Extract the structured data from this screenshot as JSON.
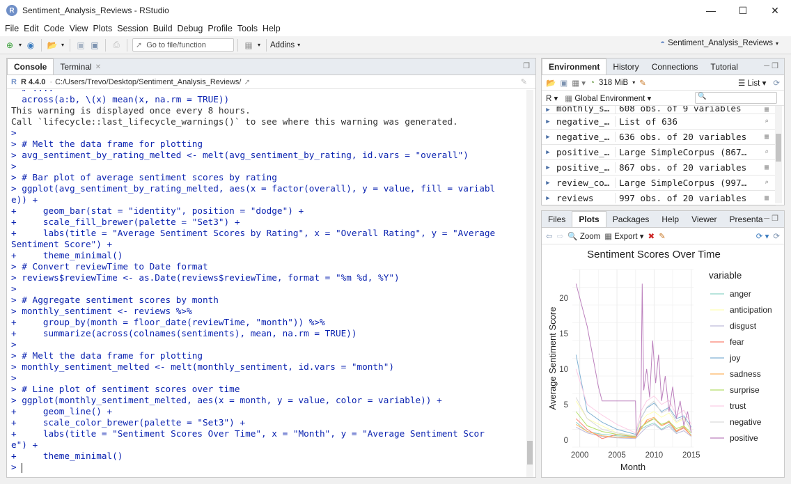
{
  "window": {
    "title": "Sentiment_Analysis_Reviews - RStudio"
  },
  "menu": [
    "File",
    "Edit",
    "Code",
    "View",
    "Plots",
    "Session",
    "Build",
    "Debug",
    "Profile",
    "Tools",
    "Help"
  ],
  "toolbar": {
    "goto_label": "Go to file/function",
    "addins_label": "Addins",
    "project_label": "Sentiment_Analysis_Reviews"
  },
  "left": {
    "tabs": [
      "Console",
      "Terminal"
    ],
    "r_version": "R 4.4.0",
    "path": "C:/Users/Trevo/Desktop/Sentiment_Analysis_Reviews/",
    "lines": [
      {
        "cls": "cmd",
        "text": "  # ...."
      },
      {
        "cls": "cmd",
        "text": "  across(a:b, \\(x) mean(x, na.rm = TRUE))"
      },
      {
        "cls": "out",
        "text": "This warning is displayed once every 8 hours."
      },
      {
        "cls": "out",
        "text": "Call `lifecycle::last_lifecycle_warnings()` to see where this warning was generated."
      },
      {
        "cls": "cmd",
        "text": ">"
      },
      {
        "cls": "cmd",
        "text": "> # Melt the data frame for plotting"
      },
      {
        "cls": "cmd",
        "text": "> avg_sentiment_by_rating_melted <- melt(avg_sentiment_by_rating, id.vars = \"overall\")"
      },
      {
        "cls": "cmd",
        "text": ">"
      },
      {
        "cls": "cmd",
        "text": "> # Bar plot of average sentiment scores by rating"
      },
      {
        "cls": "cmd",
        "text": "> ggplot(avg_sentiment_by_rating_melted, aes(x = factor(overall), y = value, fill = variabl"
      },
      {
        "cls": "cmd",
        "text": "e)) +"
      },
      {
        "cls": "cmd",
        "text": "+     geom_bar(stat = \"identity\", position = \"dodge\") +"
      },
      {
        "cls": "cmd",
        "text": "+     scale_fill_brewer(palette = \"Set3\") +"
      },
      {
        "cls": "cmd",
        "text": "+     labs(title = \"Average Sentiment Scores by Rating\", x = \"Overall Rating\", y = \"Average"
      },
      {
        "cls": "cmd",
        "text": "Sentiment Score\") +"
      },
      {
        "cls": "cmd",
        "text": "+     theme_minimal()"
      },
      {
        "cls": "cmd",
        "text": "> # Convert reviewTime to Date format"
      },
      {
        "cls": "cmd",
        "text": "> reviews$reviewTime <- as.Date(reviews$reviewTime, format = \"%m %d, %Y\")"
      },
      {
        "cls": "cmd",
        "text": ">"
      },
      {
        "cls": "cmd",
        "text": "> # Aggregate sentiment scores by month"
      },
      {
        "cls": "cmd",
        "text": "> monthly_sentiment <- reviews %>%"
      },
      {
        "cls": "cmd",
        "text": "+     group_by(month = floor_date(reviewTime, \"month\")) %>%"
      },
      {
        "cls": "cmd",
        "text": "+     summarize(across(colnames(sentiments), mean, na.rm = TRUE))"
      },
      {
        "cls": "cmd",
        "text": ">"
      },
      {
        "cls": "cmd",
        "text": "> # Melt the data frame for plotting"
      },
      {
        "cls": "cmd",
        "text": "> monthly_sentiment_melted <- melt(monthly_sentiment, id.vars = \"month\")"
      },
      {
        "cls": "cmd",
        "text": ">"
      },
      {
        "cls": "cmd",
        "text": "> # Line plot of sentiment scores over time"
      },
      {
        "cls": "cmd",
        "text": "> ggplot(monthly_sentiment_melted, aes(x = month, y = value, color = variable)) +"
      },
      {
        "cls": "cmd",
        "text": "+     geom_line() +"
      },
      {
        "cls": "cmd",
        "text": "+     scale_color_brewer(palette = \"Set3\") +"
      },
      {
        "cls": "cmd",
        "text": "+     labs(title = \"Sentiment Scores Over Time\", x = \"Month\", y = \"Average Sentiment Scor"
      },
      {
        "cls": "cmd",
        "text": "e\") +"
      },
      {
        "cls": "cmd",
        "text": "+     theme_minimal()"
      },
      {
        "cls": "cmd",
        "text": "> "
      }
    ]
  },
  "env": {
    "tabs": [
      "Environment",
      "History",
      "Connections",
      "Tutorial"
    ],
    "memory": "318 MiB",
    "list_label": "List",
    "lang": "R",
    "scope": "Global Environment",
    "rows": [
      {
        "name": "monthly_s…",
        "value": "608 obs. of 9 variables"
      },
      {
        "name": "negative_…",
        "value": "List of  636"
      },
      {
        "name": "negative_…",
        "value": "636 obs. of 20 variables"
      },
      {
        "name": "positive_…",
        "value": "Large SimpleCorpus (867…"
      },
      {
        "name": "positive_…",
        "value": "867 obs. of 20 variables"
      },
      {
        "name": "review_co…",
        "value": "Large SimpleCorpus (997…"
      },
      {
        "name": "reviews",
        "value": "997 obs. of 20 variables"
      }
    ]
  },
  "plots": {
    "tabs": [
      "Files",
      "Plots",
      "Packages",
      "Help",
      "Viewer",
      "Presenta"
    ],
    "zoom_label": "Zoom",
    "export_label": "Export"
  },
  "chart_data": {
    "type": "line",
    "title": "Sentiment Scores Over Time",
    "xlabel": "Month",
    "ylabel": "Average Sentiment Score",
    "xlim": [
      1999,
      2015.3
    ],
    "ylim": [
      -1,
      24
    ],
    "xticks": [
      2000,
      2005,
      2010,
      2015
    ],
    "yticks": [
      0,
      5,
      10,
      15,
      20
    ],
    "grid": true,
    "legend_title": "variable",
    "legend_position": "right",
    "series": [
      {
        "name": "anger",
        "color": "#8DD3C7",
        "x": [
          1999.5,
          2001,
          2003,
          2005,
          2007.5,
          2008.2,
          2009,
          2010,
          2011,
          2012,
          2013,
          2014,
          2015
        ],
        "y": [
          2.5,
          1.2,
          0.8,
          0.6,
          0.4,
          1.5,
          2.0,
          2.4,
          1.5,
          2.2,
          1.1,
          1.8,
          0.7
        ]
      },
      {
        "name": "anticipation",
        "color": "#FFFFB3",
        "x": [
          1999.5,
          2001,
          2003,
          2005,
          2007.5,
          2008.2,
          2009,
          2010,
          2011,
          2012,
          2013,
          2014,
          2015
        ],
        "y": [
          5.5,
          3.0,
          2.0,
          1.0,
          0.6,
          2.5,
          3.5,
          4.0,
          3.2,
          3.8,
          2.4,
          3.0,
          1.5
        ]
      },
      {
        "name": "disgust",
        "color": "#BEBADA",
        "x": [
          1999.5,
          2001,
          2003,
          2005,
          2007.5,
          2008.2,
          2009,
          2010,
          2011,
          2012,
          2013,
          2014,
          2015
        ],
        "y": [
          1.8,
          1.0,
          0.5,
          0.3,
          0.2,
          1.0,
          1.8,
          2.2,
          1.4,
          1.9,
          0.9,
          1.3,
          0.5
        ]
      },
      {
        "name": "fear",
        "color": "#FB8072",
        "x": [
          1999.5,
          2001,
          2003,
          2005,
          2007.5,
          2008.2,
          2009,
          2010,
          2011,
          2012,
          2013,
          2014,
          2015
        ],
        "y": [
          3.0,
          1.5,
          0.2,
          0.8,
          0.4,
          1.6,
          2.6,
          3.0,
          2.0,
          2.5,
          1.2,
          1.7,
          0.6
        ]
      },
      {
        "name": "joy",
        "color": "#80B1D3",
        "x": [
          1999.5,
          2001,
          2003,
          2005,
          2007.5,
          2008.2,
          2009,
          2010,
          2011,
          2012,
          2013,
          2014,
          2015
        ],
        "y": [
          12.0,
          4.0,
          2.5,
          1.5,
          0.8,
          3.0,
          4.5,
          5.2,
          4.0,
          4.6,
          3.0,
          3.4,
          1.8
        ]
      },
      {
        "name": "sadness",
        "color": "#FDB462",
        "x": [
          1999.5,
          2001,
          2003,
          2005,
          2007.5,
          2008.2,
          2009,
          2010,
          2011,
          2012,
          2013,
          2014,
          2015
        ],
        "y": [
          2.2,
          1.2,
          0.6,
          0.4,
          0.3,
          1.5,
          2.8,
          3.2,
          2.0,
          2.7,
          1.3,
          1.9,
          0.6
        ]
      },
      {
        "name": "surprise",
        "color": "#B3DE69",
        "x": [
          1999.5,
          2001,
          2003,
          2005,
          2007.5,
          2008.2,
          2009,
          2010,
          2011,
          2012,
          2013,
          2014,
          2015
        ],
        "y": [
          4.0,
          2.0,
          1.2,
          0.8,
          0.5,
          1.8,
          2.4,
          3.0,
          2.2,
          2.6,
          1.6,
          2.0,
          1.0
        ]
      },
      {
        "name": "trust",
        "color": "#FCCDE5",
        "x": [
          1999.5,
          2001,
          2003,
          2005,
          2007.5,
          2008.2,
          2009,
          2010,
          2011,
          2012,
          2013,
          2014,
          2015
        ],
        "y": [
          10.0,
          5.0,
          3.5,
          2.2,
          1.0,
          4.0,
          5.5,
          6.2,
          5.0,
          5.6,
          3.5,
          4.2,
          2.2
        ]
      },
      {
        "name": "negative",
        "color": "#D9D9D9",
        "x": [
          1999.5,
          2001,
          2003,
          2005,
          2007.5,
          2008.2,
          2009,
          2010,
          2011,
          2012,
          2013,
          2014,
          2015
        ],
        "y": [
          6.0,
          3.0,
          1.5,
          1.0,
          0.6,
          3.0,
          4.6,
          5.5,
          3.8,
          4.4,
          2.6,
          3.2,
          1.2
        ]
      },
      {
        "name": "positive",
        "color": "#BC80BD",
        "x": [
          1999.5,
          2001,
          2002.5,
          2003,
          2007.5,
          2007.6,
          2008.2,
          2008.4,
          2008.6,
          2009,
          2009.4,
          2009.8,
          2010.2,
          2010.6,
          2011,
          2011.5,
          2012,
          2012.5,
          2013,
          2013.5,
          2014,
          2014.5,
          2015
        ],
        "y": [
          22.0,
          16.0,
          7.5,
          5.5,
          5.5,
          0.5,
          2.0,
          22.0,
          7.0,
          10.0,
          6.0,
          14.0,
          8.0,
          12.0,
          5.5,
          9.0,
          4.0,
          7.5,
          3.0,
          5.5,
          2.0,
          4.0,
          1.0
        ]
      }
    ]
  }
}
